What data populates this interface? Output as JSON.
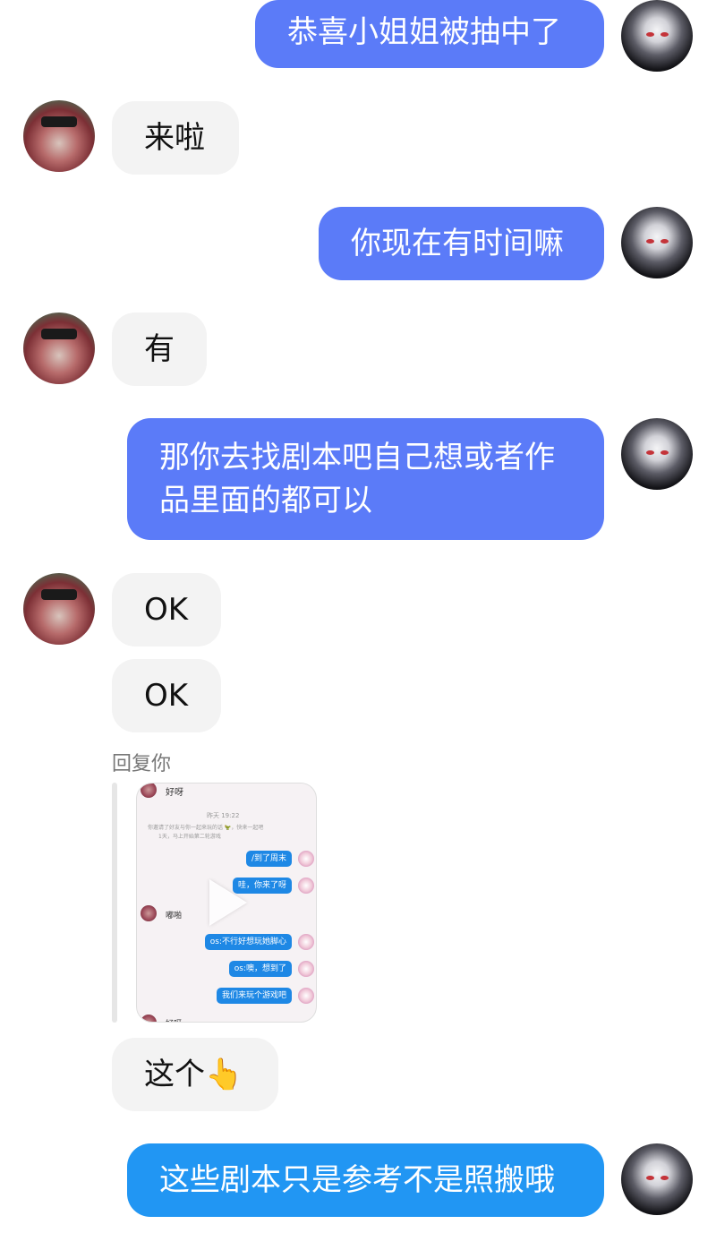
{
  "messages": {
    "m1": "恭喜小姐姐被抽中了",
    "m2": "来啦",
    "m3": "你现在有时间嘛",
    "m4": "有",
    "m5_line1": "那你去找剧本吧自己想或者作",
    "m5_line2": "品里面的都可以",
    "m6": "OK",
    "m7": "OK",
    "m8_text": "这个",
    "m8_emoji": "👆",
    "m9": "这些剧本只是参考不是照搬哦"
  },
  "reply": {
    "label": "回复你",
    "thumbnail": {
      "top_name": "好呀",
      "time": "昨天 19:22",
      "notice_line1": "你邀请了好友与你一起来玩的话 🦖，快来一起吧",
      "notice_line2": "1天，马上开始第二轮游戏",
      "messages": [
        "/到了周末",
        "哇，你来了呀",
        "os:不行好想玩她脚心",
        "os:噢，想到了",
        "我们来玩个游戏吧"
      ],
      "other_name": "嘟啪",
      "bottom_name": "好呀"
    }
  },
  "colors": {
    "self_bubble": "#5b7bf8",
    "self_bubble_last": "#2196f3",
    "other_bubble": "#f3f3f3"
  },
  "icons": [
    "avatar-self",
    "avatar-other",
    "play-icon",
    "pointing-up-emoji"
  ]
}
